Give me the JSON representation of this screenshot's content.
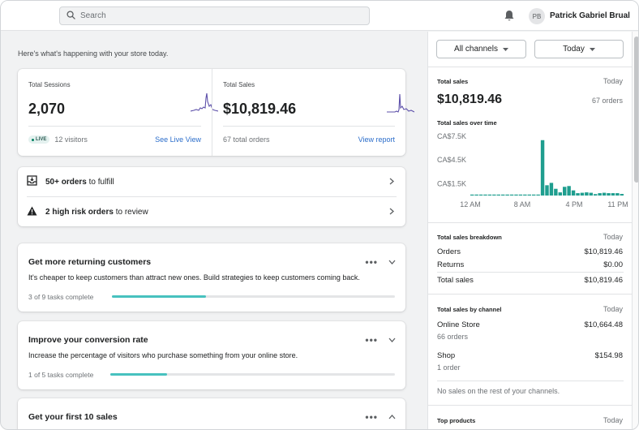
{
  "search": {
    "placeholder": "Search"
  },
  "user": {
    "initials": "PB",
    "name": "Patrick Gabriel Brual"
  },
  "greeting": "Here's what's happening with your store today.",
  "metrics": {
    "sessions": {
      "label": "Total Sessions",
      "value": "2,070",
      "live_badge": "LIVE",
      "visitors": "12 visitors",
      "link": "See Live View"
    },
    "sales": {
      "label": "Total Sales",
      "value": "$10,819.46",
      "orders": "67 total orders",
      "link": "View report"
    }
  },
  "todos": [
    {
      "bold": "50+ orders",
      "rest": " to fulfill"
    },
    {
      "bold": "2 high risk orders",
      "rest": " to review"
    }
  ],
  "tasks": [
    {
      "title": "Get more returning customers",
      "description": "It's cheaper to keep customers than attract new ones. Build strategies to keep customers coming back.",
      "progress_text": "3 of 9 tasks complete",
      "progress": 0.333
    },
    {
      "title": "Improve your conversion rate",
      "description": "Increase the percentage of visitors who purchase something from your online store.",
      "progress_text": "1 of 5 tasks complete",
      "progress": 0.2
    },
    {
      "title": "Get your first 10 sales",
      "description": "",
      "progress_text": "",
      "progress": 0
    }
  ],
  "filters": {
    "channel": "All channels",
    "period": "Today"
  },
  "total_sales": {
    "title": "Total sales",
    "date": "Today",
    "value": "$10,819.46",
    "orders": "67 orders",
    "chart_title": "Total sales over time"
  },
  "chart_data": {
    "type": "bar",
    "yticks": [
      "CA$7.5K",
      "CA$4.5K",
      "CA$1.5K"
    ],
    "ytick_values": [
      7500,
      4500,
      1500
    ],
    "xticks": [
      "12 AM",
      "8 AM",
      "4 PM",
      "11 PM"
    ],
    "ylim": [
      0,
      8000
    ],
    "values": [
      120,
      120,
      120,
      120,
      120,
      120,
      120,
      120,
      120,
      120,
      120,
      120,
      120,
      120,
      120,
      120,
      7000,
      1300,
      1600,
      850,
      400,
      1100,
      1200,
      650,
      300,
      350,
      400,
      350,
      180,
      300,
      350,
      300,
      300,
      300,
      200
    ],
    "color": "#1f9e8f"
  },
  "breakdown": {
    "title": "Total sales breakdown",
    "date": "Today",
    "rows": [
      {
        "label": "Orders",
        "value": "$10,819.46"
      },
      {
        "label": "Returns",
        "value": "$0.00"
      },
      {
        "label": "Total sales",
        "value": "$10,819.46"
      }
    ]
  },
  "by_channel": {
    "title": "Total sales by channel",
    "date": "Today",
    "rows": [
      {
        "label": "Online Store",
        "value": "$10,664.48",
        "sub": "66 orders"
      },
      {
        "label": "Shop",
        "value": "$154.98",
        "sub": "1 order"
      }
    ],
    "note": "No sales on the rest of your channels."
  },
  "top_products": {
    "title": "Top products",
    "date": "Today"
  }
}
